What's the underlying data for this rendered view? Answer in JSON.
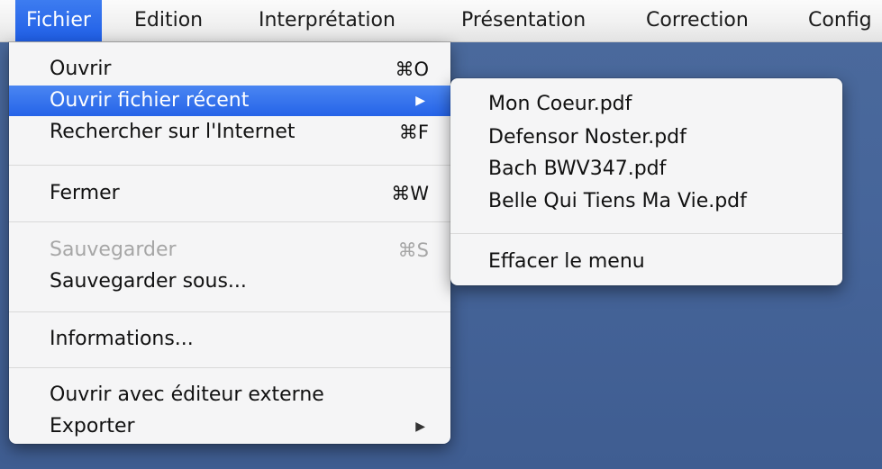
{
  "menubar": {
    "items": [
      {
        "label": "Fichier"
      },
      {
        "label": "Edition"
      },
      {
        "label": "Interprétation"
      },
      {
        "label": "Présentation"
      },
      {
        "label": "Correction"
      },
      {
        "label": "Config"
      }
    ]
  },
  "file_menu": {
    "items": [
      {
        "label": "Ouvrir",
        "shortcut": "⌘O"
      },
      {
        "label": "Ouvrir fichier récent",
        "arrow": "▶"
      },
      {
        "label": "Rechercher sur l'Internet",
        "shortcut": "⌘F"
      },
      {
        "label": "Fermer",
        "shortcut": "⌘W"
      },
      {
        "label": "Sauvegarder",
        "shortcut": "⌘S"
      },
      {
        "label": "Sauvegarder sous..."
      },
      {
        "label": "Informations..."
      },
      {
        "label": "Ouvrir avec éditeur externe"
      },
      {
        "label": "Exporter",
        "arrow": "▶"
      }
    ]
  },
  "recent_submenu": {
    "items": [
      {
        "label": "Mon Coeur.pdf"
      },
      {
        "label": "Defensor Noster.pdf"
      },
      {
        "label": "Bach BWV347.pdf"
      },
      {
        "label": "Belle Qui Tiens Ma Vie.pdf"
      },
      {
        "label": "Effacer le menu"
      }
    ]
  },
  "colors": {
    "highlight": "#2563e8",
    "desktop": "#46659a",
    "disabled_text": "#a6a6a6"
  }
}
